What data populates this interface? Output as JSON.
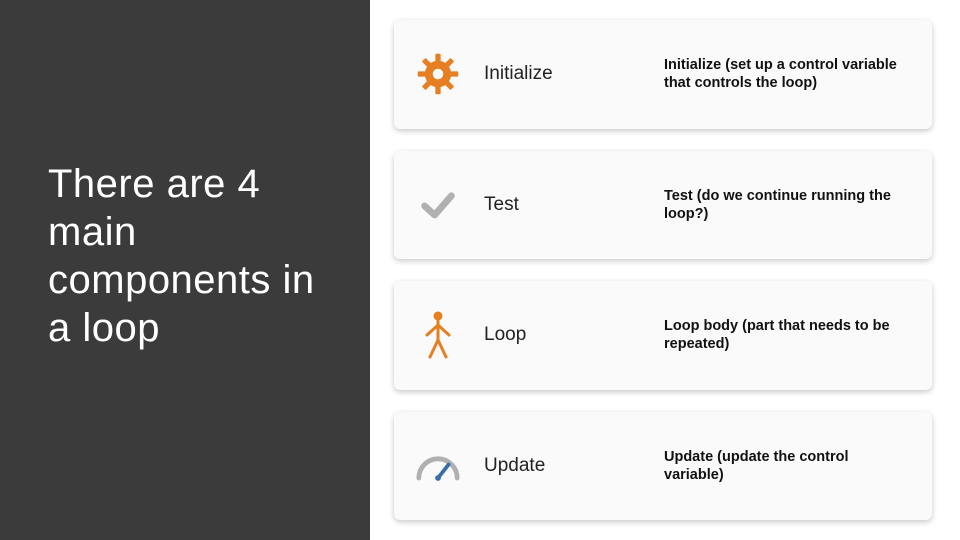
{
  "header": {
    "title": "There are 4 main components in a loop"
  },
  "colors": {
    "icon": "#e67e22",
    "icon_muted": "#b0b0b0",
    "panel": "#3b3b3b"
  },
  "components": [
    {
      "icon": "gear-icon",
      "title": "Initialize",
      "description": "Initialize (set up a control variable that controls the loop)"
    },
    {
      "icon": "check-icon",
      "title": "Test",
      "description": "Test (do we continue running the loop?)"
    },
    {
      "icon": "person-icon",
      "title": "Loop",
      "description": "Loop body (part that needs to be repeated)"
    },
    {
      "icon": "gauge-icon",
      "title": "Update",
      "description": "Update (update the control variable)"
    }
  ]
}
